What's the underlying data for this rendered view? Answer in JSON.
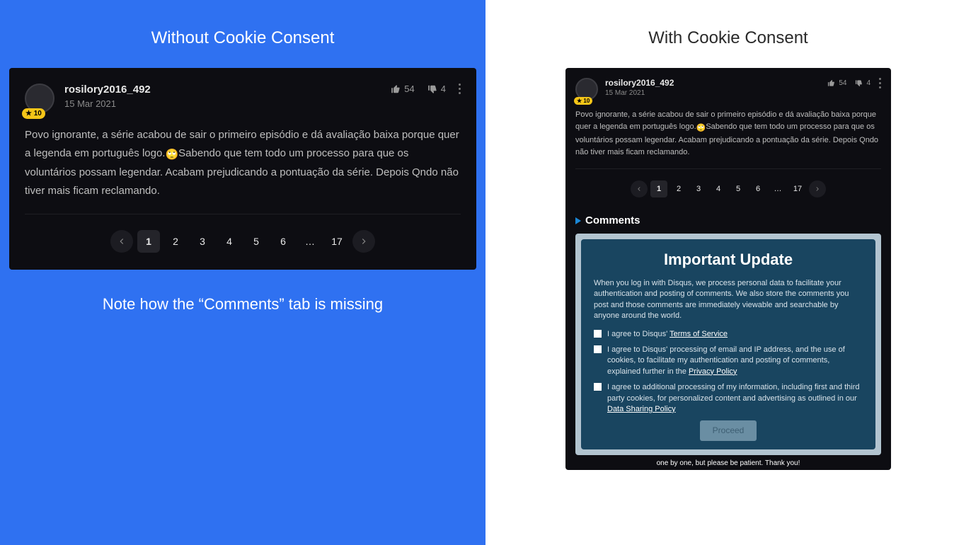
{
  "left": {
    "heading": "Without Cookie Consent",
    "note": "Note how the “Comments” tab is missing"
  },
  "right": {
    "heading": "With Cookie Consent"
  },
  "comment": {
    "username": "rosilory2016_492",
    "badge": "★ 10",
    "date": "15 Mar 2021",
    "upvotes": "54",
    "downvotes": "4",
    "body_a": "Povo ignorante, a série acabou de sair o primeiro episódio e dá avaliação baixa porque quer a legenda em português logo.",
    "emoji": "🙄",
    "body_b": "Sabendo que tem todo um processo para que os voluntários possam legendar. Acabam prejudicando a pontuação da série. Depois Qndo não tiver mais ficam reclamando."
  },
  "pager": {
    "pages": [
      "1",
      "2",
      "3",
      "4",
      "5",
      "6"
    ],
    "ellipsis": "…",
    "last": "17"
  },
  "comments_section": {
    "label": "Comments"
  },
  "consent": {
    "title": "Important Update",
    "intro": "When you log in with Disqus, we process personal data to facilitate your authentication and posting of comments. We also store the comments you post and those comments are immediately viewable and searchable by anyone around the world.",
    "item1_a": "I agree to Disqus' ",
    "item1_link": "Terms of Service",
    "item2_a": "I agree to Disqus' processing of email and IP address, and the use of cookies, to facilitate my authentication and posting of comments, explained further in the ",
    "item2_link": "Privacy Policy",
    "item3_a": "I agree to additional processing of my information, including first and third party cookies, for personalized content and advertising as outlined in our ",
    "item3_link": "Data Sharing Policy",
    "proceed": "Proceed",
    "footer": "one by one, but please be patient. Thank you!"
  }
}
